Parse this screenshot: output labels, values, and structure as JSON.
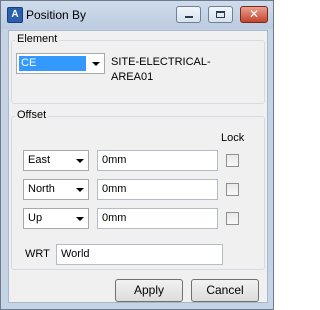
{
  "window": {
    "title": "Position By",
    "app_icon_glyph": "A"
  },
  "element": {
    "group_label": "Element",
    "combo_value": "CE",
    "name_line1": "SITE-ELECTRICAL-",
    "name_line2": "AREA01"
  },
  "offset": {
    "group_label": "Offset",
    "lock_label": "Lock",
    "rows": [
      {
        "direction": "East",
        "value": "0mm",
        "locked": false
      },
      {
        "direction": "North",
        "value": "0mm",
        "locked": false
      },
      {
        "direction": "Up",
        "value": "0mm",
        "locked": false
      }
    ],
    "wrt_label": "WRT",
    "wrt_value": "World"
  },
  "buttons": {
    "apply": "Apply",
    "cancel": "Cancel"
  },
  "icons": {
    "app": "app-logo-icon",
    "minimize": "minimize-icon",
    "maximize": "maximize-icon",
    "close": "close-icon",
    "dropdown": "chevron-down-icon"
  }
}
